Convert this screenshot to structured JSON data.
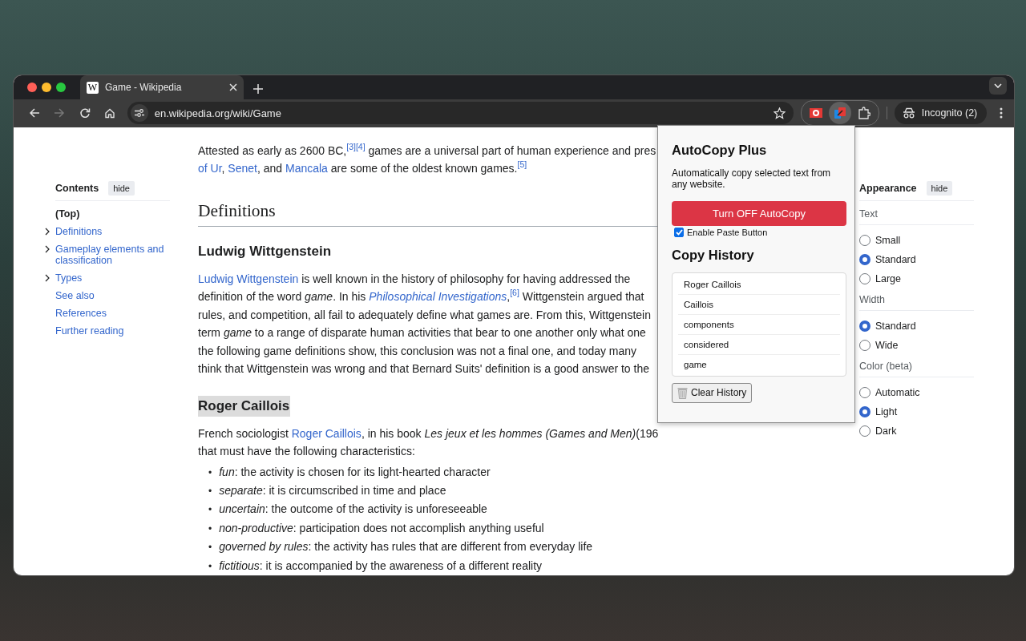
{
  "browser": {
    "tabs": [
      {
        "favicon": "W",
        "title": "Game - Wikipedia",
        "selected": true
      }
    ],
    "navigation": [
      {
        "kind": "back",
        "disabled": false
      },
      {
        "kind": "forward",
        "disabled": true
      },
      {
        "kind": "reload",
        "disabled": false
      },
      {
        "kind": "home",
        "disabled": false
      }
    ],
    "address": {
      "url": "en.wikipedia.org/wiki/Game"
    },
    "extensions": [
      {
        "kind": "camera",
        "selected": false
      },
      {
        "kind": "copy-link",
        "selected": true
      },
      {
        "kind": "puzzle",
        "selected": false
      }
    ],
    "profile": {
      "label": "Incognito (2)"
    }
  },
  "toc": {
    "title": "Contents",
    "hide": "hide",
    "items": [
      {
        "label": "(Top)",
        "current": true,
        "expandable": false
      },
      {
        "label": "Definitions",
        "current": false,
        "expandable": true
      },
      {
        "label": "Gameplay elements and classification",
        "current": false,
        "expandable": true
      },
      {
        "label": "Types",
        "current": false,
        "expandable": true
      },
      {
        "label": "See also",
        "current": false,
        "expandable": false
      },
      {
        "label": "References",
        "current": false,
        "expandable": false
      },
      {
        "label": "Further reading",
        "current": false,
        "expandable": false
      }
    ]
  },
  "article": {
    "blocks": [
      {
        "kind": "paragraph",
        "lines": [
          [
            {
              "kind": "text",
              "text": "Attested as early as 2600 BC,"
            },
            {
              "kind": "citation",
              "text": "[3][4]"
            },
            {
              "kind": "text",
              "text": " games are a universal part of human experience and pres"
            }
          ],
          [
            {
              "kind": "link",
              "text": "of Ur"
            },
            {
              "kind": "text",
              "text": ", "
            },
            {
              "kind": "link",
              "text": "Senet"
            },
            {
              "kind": "text",
              "text": ", and "
            },
            {
              "kind": "link",
              "text": "Mancala"
            },
            {
              "kind": "text",
              "text": " are some of the oldest known games."
            },
            {
              "kind": "citation",
              "text": "[5]"
            }
          ]
        ]
      },
      {
        "kind": "h2",
        "text": "Definitions"
      },
      {
        "kind": "h3",
        "text": "Ludwig Wittgenstein",
        "highlighted": false
      },
      {
        "kind": "paragraph",
        "lines": [
          [
            {
              "kind": "link",
              "text": "Ludwig Wittgenstein"
            },
            {
              "kind": "text",
              "text": " is well known in the history of philosophy for having addressed the"
            }
          ],
          [
            {
              "kind": "text",
              "text": "definition of the word *game*. In his "
            },
            {
              "kind": "link",
              "text": "Philosophical Investigations",
              "italic": true
            },
            {
              "kind": "text",
              "text": ","
            },
            {
              "kind": "citation",
              "text": "[6]"
            },
            {
              "kind": "text",
              "text": " Wittgenstein argued that"
            }
          ],
          [
            {
              "kind": "text",
              "text": "rules, and competition, all fail to adequately define what games are. From this, Wittgenstein"
            }
          ],
          [
            {
              "kind": "text",
              "text": "term *game* to a range of disparate human activities that bear to one another only what one"
            }
          ],
          [
            {
              "kind": "text",
              "text": "the following game definitions show, this conclusion was not a final one, and today many"
            }
          ],
          [
            {
              "kind": "text",
              "text": "think that Wittgenstein was wrong and that Bernard Suits' definition is a good answer to the"
            }
          ]
        ]
      },
      {
        "kind": "h3",
        "text": "Roger Caillois",
        "highlighted": true
      },
      {
        "kind": "paragraph",
        "lines": [
          [
            {
              "kind": "text",
              "text": "French sociologist "
            },
            {
              "kind": "link",
              "text": "Roger Caillois"
            },
            {
              "kind": "text",
              "text": ", in his book *Les jeux et les hommes (Games and Men)*(196"
            }
          ],
          [
            {
              "kind": "text",
              "text": "that must have the following characteristics:"
            }
          ]
        ]
      },
      {
        "kind": "list",
        "marker": "•",
        "items": [
          "*fun*: the activity is chosen for its light-hearted character",
          "*separate*: it is circumscribed in time and place",
          "*uncertain*: the outcome of the activity is unforeseeable",
          "*non-productive*: participation does not accomplish anything useful",
          "*governed by rules*: the activity has rules that are different from everyday life",
          "*fictitious*: it is accompanied by the awareness of a different reality"
        ]
      }
    ]
  },
  "appearance": {
    "title": "Appearance",
    "hide": "hide",
    "groups": [
      {
        "label": "Text",
        "options": [
          {
            "label": "Small",
            "selected": false
          },
          {
            "label": "Standard",
            "selected": true
          },
          {
            "label": "Large",
            "selected": false
          }
        ]
      },
      {
        "label": "Width",
        "options": [
          {
            "label": "Standard",
            "selected": true
          },
          {
            "label": "Wide",
            "selected": false
          }
        ]
      },
      {
        "label": "Color (beta)",
        "options": [
          {
            "label": "Automatic",
            "selected": false
          },
          {
            "label": "Light",
            "selected": true
          },
          {
            "label": "Dark",
            "selected": false
          }
        ]
      }
    ]
  },
  "popup": {
    "title": "AutoCopy Plus",
    "description": "Automatically copy selected text from any website.",
    "toggle_button": "Turn OFF AutoCopy",
    "paste_option": {
      "label": "Enable Paste Button",
      "checked": true
    },
    "history_title": "Copy History",
    "history": [
      "Roger Caillois",
      "Caillois",
      "components",
      "considered",
      "game"
    ],
    "clear_button": "Clear History"
  }
}
